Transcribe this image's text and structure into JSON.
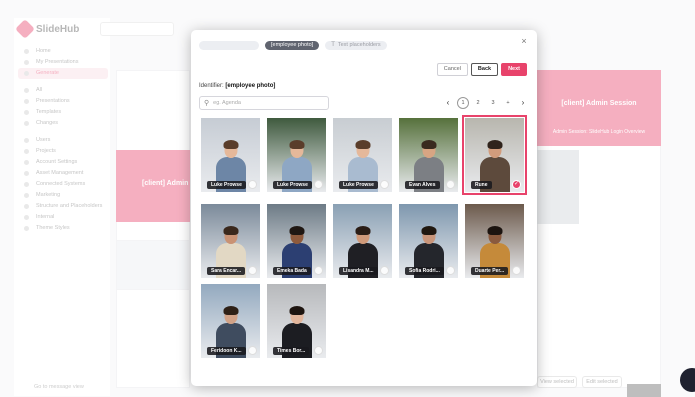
{
  "background": {
    "brand_name": "SlideHub",
    "search_placeholder": "Search",
    "nav_items": [
      {
        "label": "Home"
      },
      {
        "label": "My Presentations"
      },
      {
        "label": "Generate",
        "active": true
      },
      {
        "label": "All"
      },
      {
        "label": "Presentations"
      },
      {
        "label": "Templates"
      },
      {
        "label": "Changes"
      },
      {
        "label": "Users"
      },
      {
        "label": "Projects"
      },
      {
        "label": "Account Settings"
      },
      {
        "label": "Asset Management"
      },
      {
        "label": "Connected Systems"
      },
      {
        "label": "Marketing"
      },
      {
        "label": "Structure and Placeholders"
      },
      {
        "label": "Internal"
      },
      {
        "label": "Theme Styles"
      }
    ],
    "sidebar_footer": "Go to message view",
    "slide_title_left": "[client] Admin",
    "slide_title_right": "[client] Admin Session",
    "slide_subtitle_right": "Admin Session: SlideHub Login Overview",
    "btn_view_selected": "View selected",
    "btn_edit_selected": "Edit selected"
  },
  "modal": {
    "tags": [
      {
        "label": "",
        "style": "ghost"
      },
      {
        "label": "[employee photo]",
        "style": "active"
      },
      {
        "label": "Text placeholders",
        "style": "light",
        "icon": "text-icon"
      }
    ],
    "actions": {
      "cancel": "Cancel",
      "back": "Back",
      "next": "Next"
    },
    "identifier_label": "Identifier:",
    "identifier_value": "[employee photo]",
    "search_placeholder": "eg. Agenda",
    "pagination": {
      "current": 1,
      "pages": [
        "1",
        "2",
        "3",
        "+"
      ]
    },
    "photos": [
      {
        "name": "Luke Prowse",
        "selected": false,
        "bg": "#c6ccd4",
        "skin": "#e5b89a",
        "hair": "#5a3d2a",
        "shirt": "#6d86a6"
      },
      {
        "name": "Luke Prowse",
        "selected": false,
        "bg": "#3f5a3e",
        "skin": "#e5b89a",
        "hair": "#5a3d2a",
        "shirt": "#8ea7c4"
      },
      {
        "name": "Luke Prowse",
        "selected": false,
        "bg": "#c8cdd2",
        "skin": "#e5b89a",
        "hair": "#5a3d2a",
        "shirt": "#a9bbd0"
      },
      {
        "name": "Evan Alves",
        "selected": false,
        "bg": "#56713c",
        "skin": "#d7a583",
        "hair": "#3a2a1f",
        "shirt": "#7c7f84"
      },
      {
        "name": "Rune",
        "selected": true,
        "bg": "#b8b6ae",
        "skin": "#d29c7c",
        "hair": "#2f231c",
        "shirt": "#5d4a3c"
      },
      {
        "name": "Sara Encar...",
        "selected": false,
        "bg": "#7b8a9a",
        "skin": "#c99274",
        "hair": "#3a281c",
        "shirt": "#e2d8c4"
      },
      {
        "name": "Emeka Bada",
        "selected": false,
        "bg": "#6d7b86",
        "skin": "#8e5a3c",
        "hair": "#1f1712",
        "shirt": "#2c3f72"
      },
      {
        "name": "Lisandra M...",
        "selected": false,
        "bg": "#8aa0b4",
        "skin": "#d09a7a",
        "hair": "#2a1d16",
        "shirt": "#1f1f24"
      },
      {
        "name": "Sofia Rodri...",
        "selected": false,
        "bg": "#7e97ae",
        "skin": "#c9957a",
        "hair": "#20170f",
        "shirt": "#24262c"
      },
      {
        "name": "Duarte Per...",
        "selected": false,
        "bg": "#6c5a4c",
        "skin": "#8a5a3e",
        "hair": "#1c1410",
        "shirt": "#c58a3a"
      },
      {
        "name": "Feridoon K...",
        "selected": false,
        "bg": "#93a9bf",
        "skin": "#d1a287",
        "hair": "#2e2016",
        "shirt": "#3f4c5f"
      },
      {
        "name": "Times Bor...",
        "selected": false,
        "bg": "#b7b9bc",
        "skin": "#e2b69c",
        "hair": "#1e1510",
        "shirt": "#1c1d22"
      }
    ]
  }
}
